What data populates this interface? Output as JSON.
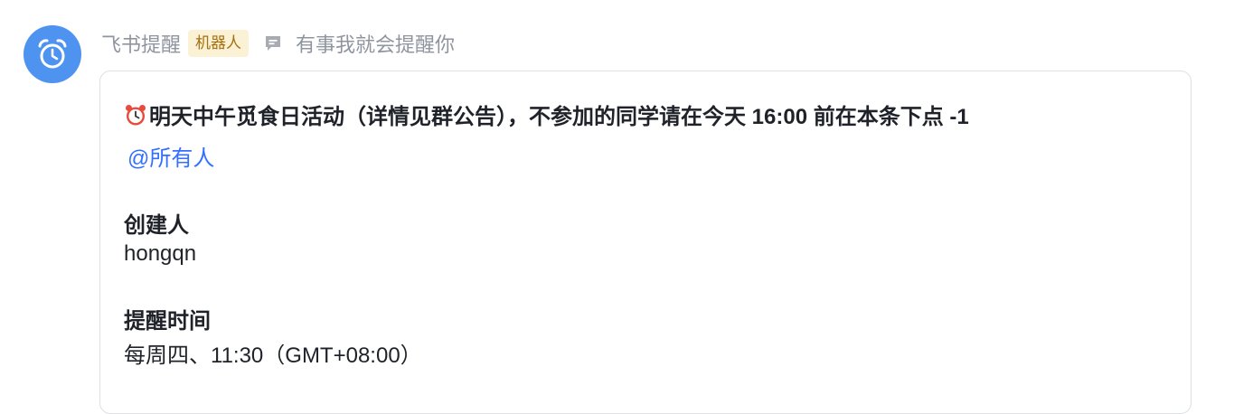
{
  "sender": {
    "name": "飞书提醒",
    "badge": "机器人",
    "signature": "有事我就会提醒你",
    "avatar_icon": "alarm-clock-icon",
    "avatar_color": "#4f93f0"
  },
  "message": {
    "title": "明天中午觅食日活动（详情见群公告），不参加的同学请在今天 16:00 前在本条下点 -1",
    "title_icon": "alarm-clock-emoji",
    "mention": "@所有人",
    "fields": [
      {
        "label": "创建人",
        "value": "hongqn"
      },
      {
        "label": "提醒时间",
        "value": "每周四、11:30（GMT+08:00）"
      }
    ]
  },
  "colors": {
    "mention": "#3370ff",
    "badge_bg": "#fbf1d5",
    "badge_text": "#a5700f",
    "muted_text": "#8f959e"
  }
}
